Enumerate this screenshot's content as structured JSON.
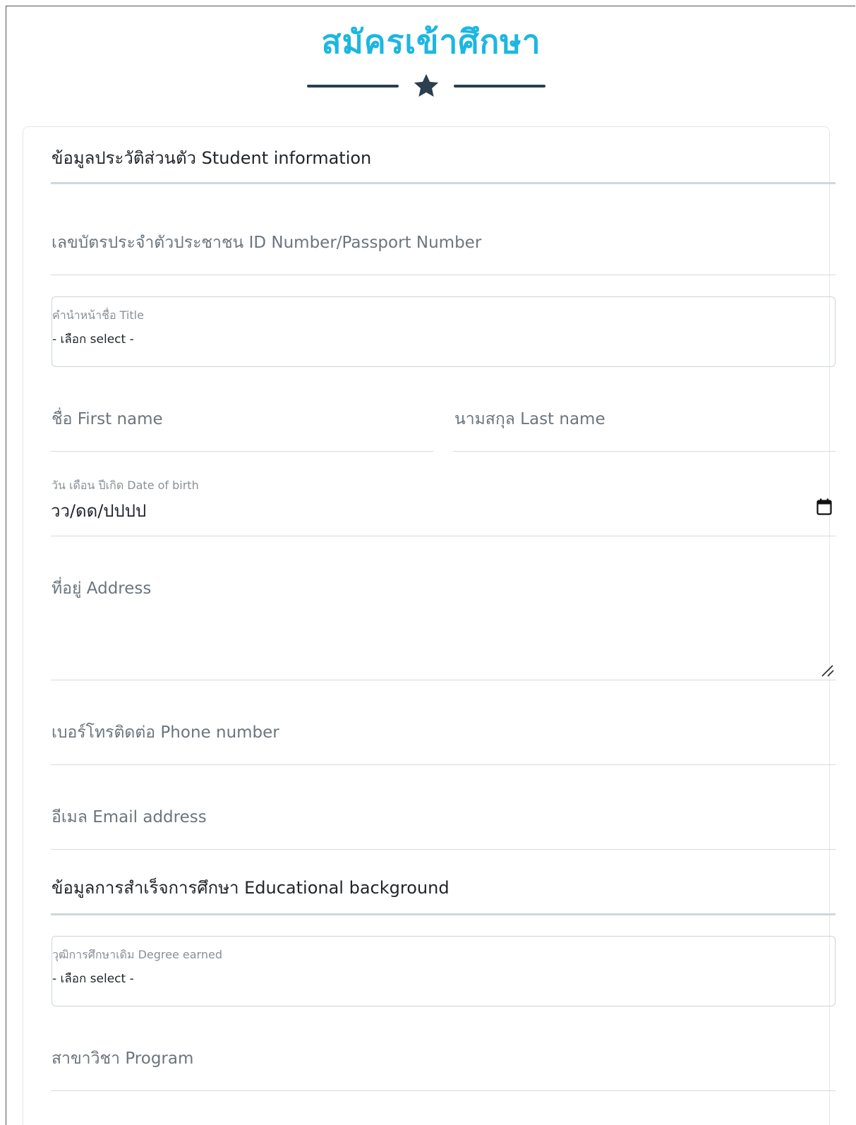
{
  "header": {
    "title": "สมัครเข้าศึกษา",
    "star_icon": "star-icon"
  },
  "student_section": {
    "title": "ข้อมูลประวัติส่วนตัว Student information",
    "id_number": {
      "label": "เลขบัตรประจำตัวประชาชน ID Number/Passport Number"
    },
    "title_select": {
      "label": "คำนำหน้าชื่อ Title",
      "value": "- เลือก select -"
    },
    "first_name": {
      "label": "ชื่อ First name"
    },
    "last_name": {
      "label": "นามสกุล Last name"
    },
    "dob": {
      "label": "วัน เดือน ปีเกิด Date of birth",
      "value": "วว/ดด/ปปปป",
      "icon": "calendar-icon"
    },
    "address": {
      "label": "ที่อยู่ Address",
      "icon": "resize-handle-icon"
    },
    "phone": {
      "label": "เบอร์โทรติดต่อ Phone number"
    },
    "email": {
      "label": "อีเมล Email address"
    }
  },
  "education_section": {
    "title": "ข้อมูลการสำเร็จการศึกษา Educational background",
    "degree_select": {
      "label": "วุฒิการศึกษาเดิม Degree earned",
      "value": "- เลือก select -"
    },
    "program": {
      "label": "สาขาวิชา Program"
    }
  },
  "colors": {
    "title": "#1cb7e0",
    "divider": "#2c3e50",
    "section_rule": "#cfd8dc",
    "label": "#6c757d"
  }
}
